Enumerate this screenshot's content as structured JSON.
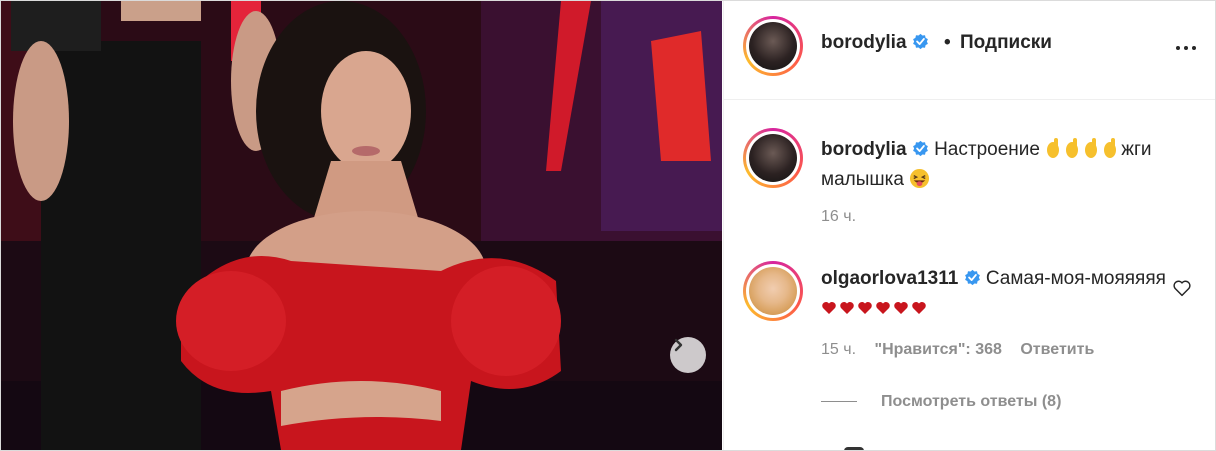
{
  "post": {
    "author": "borodylia",
    "follow_label": "Подписки",
    "separator": "•"
  },
  "caption": {
    "username": "borodylia",
    "text_before": "Настроение ",
    "text_after": "жги малышка",
    "time": "16 ч."
  },
  "comments": [
    {
      "username": "olgaorlova1311",
      "text": "Самая-моя-мояяяяя",
      "time": "15 ч.",
      "likes_label": "\"Нравится\": 368",
      "reply_label": "Ответить",
      "view_replies": "Посмотреть ответы (8)"
    }
  ],
  "icons": {
    "verified": "verified-badge-icon",
    "more": "more-options-icon",
    "next": "chevron-right-icon",
    "like": "heart-outline-icon"
  },
  "colors": {
    "verified_blue": "#3897f0",
    "muted": "#8e8e8e",
    "text": "#262626",
    "dress_red": "#c8151d"
  }
}
